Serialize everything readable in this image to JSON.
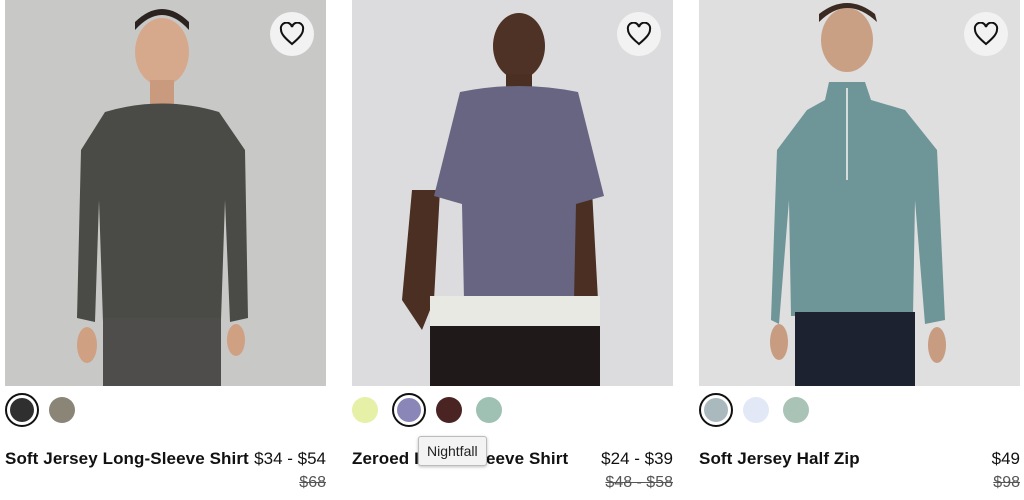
{
  "products": [
    {
      "name": "Soft Jersey Long-Sleeve Shirt",
      "price": "$34 - $54",
      "was_price": "$68",
      "swatches": [
        {
          "name": "dark-heather",
          "color": "#2f2f2f",
          "selected": true
        },
        {
          "name": "tan-heather",
          "color": "#8a8577",
          "selected": false
        }
      ]
    },
    {
      "name": "Zoeroed In Short-Sleeve Shirt",
      "name_visible_start": "Zeroed I",
      "name_visible_end": "eeve Shirt",
      "price": "$24 - $39",
      "was_price": "$48 - $58",
      "swatches": [
        {
          "name": "lime",
          "color": "#e6f0a6",
          "selected": false
        },
        {
          "name": "nightfall",
          "color": "#8a86b7",
          "selected": true
        },
        {
          "name": "maroon",
          "color": "#4a2323",
          "selected": false
        },
        {
          "name": "sage",
          "color": "#9ec1b4",
          "selected": false
        }
      ]
    },
    {
      "name": "Soft Jersey Half Zip",
      "price": "$49",
      "was_price": "$98",
      "swatches": [
        {
          "name": "grey-teal",
          "color": "#aab9bd",
          "selected": true
        },
        {
          "name": "light-blue",
          "color": "#e3e8f6",
          "selected": false
        },
        {
          "name": "sage",
          "color": "#a9c3b7",
          "selected": false
        }
      ]
    }
  ],
  "tooltip": {
    "text": "Nightfall"
  },
  "icons": {
    "favorite": "heart-outline-icon"
  }
}
